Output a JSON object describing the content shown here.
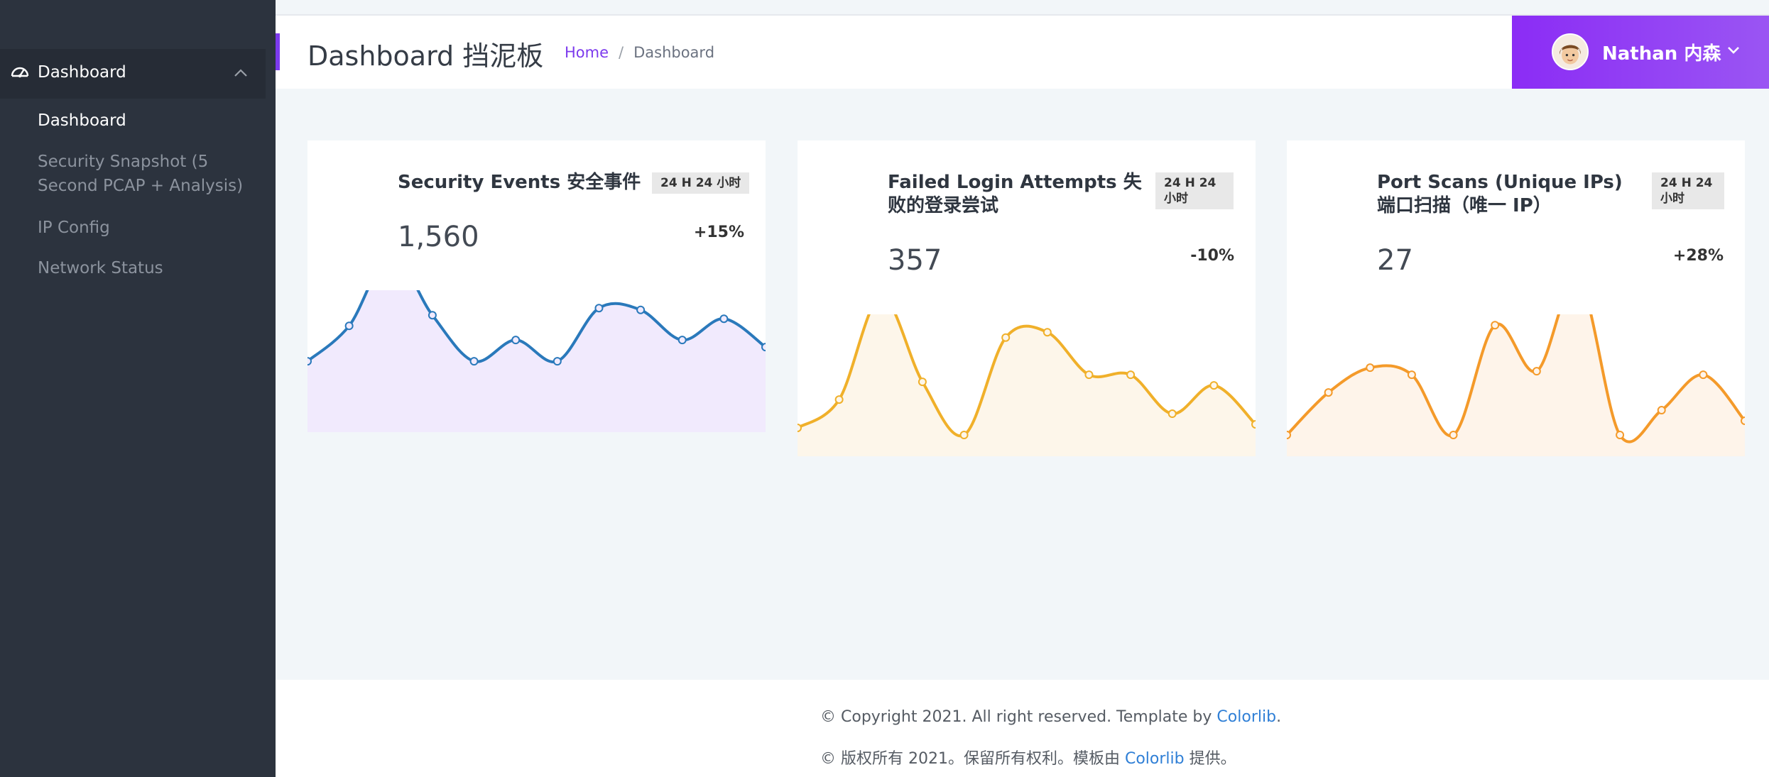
{
  "sidebar": {
    "group": {
      "label": "Dashboard",
      "icon": "dashboard-gauge-icon"
    },
    "items": [
      {
        "label": "Dashboard",
        "active": true
      },
      {
        "label": "Security Snapshot (5",
        "label2": "Second PCAP + Analysis)"
      },
      {
        "label": "IP Config"
      },
      {
        "label": "Network Status"
      }
    ]
  },
  "header": {
    "title": "Dashboard 挡泥板",
    "breadcrumb": {
      "home": "Home",
      "separator": "/",
      "current": "Dashboard"
    },
    "user": {
      "name": "Nathan 内森",
      "icon": "chevron-down-icon"
    }
  },
  "cards": [
    {
      "title": "Security Events 安全事件",
      "badge": "24 H 24 小时",
      "value": "1,560",
      "change": "+15%",
      "line_color": "#2a79bb",
      "fill_color": "#f1eafd",
      "points": [
        28,
        48,
        88,
        54,
        28,
        40,
        28,
        58,
        57,
        40,
        52,
        36
      ]
    },
    {
      "title": "Failed Login Attempts 失败的登录尝试",
      "badge": "24 H 24 小时",
      "value": "357",
      "change": "-10%",
      "line_color": "#f0b02a",
      "fill_color": "#fdf6ea",
      "points": [
        4,
        20,
        78,
        30,
        0,
        55,
        58,
        34,
        34,
        12,
        28,
        6
      ]
    },
    {
      "title": "Port Scans (Unique IPs) 端口扫描（唯一 IP）",
      "badge": "24 H 24 小时",
      "value": "27",
      "change": "+28%",
      "line_color": "#f49a2a",
      "fill_color": "#fef4ea",
      "points": [
        0,
        24,
        38,
        34,
        0,
        62,
        36,
        88,
        0,
        14,
        34,
        8
      ]
    }
  ],
  "footer": {
    "line1_prefix": "© Copyright 2021. All right reserved. Template by ",
    "line1_link": "Colorlib",
    "line1_suffix": ".",
    "line2_prefix": "© 版权所有 2021。保留所有权利。模板由 ",
    "line2_link": "Colorlib",
    "line2_suffix": " 提供。"
  }
}
